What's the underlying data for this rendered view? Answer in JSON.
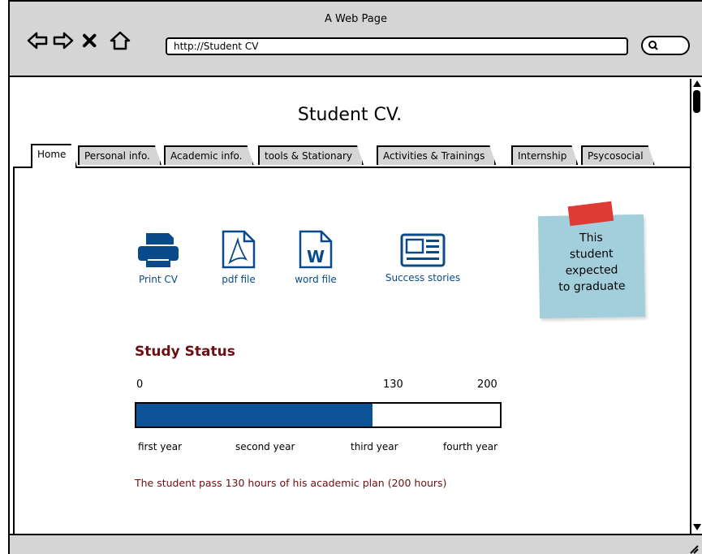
{
  "window": {
    "title": "A Web Page"
  },
  "toolbar": {
    "url": "http://Student CV"
  },
  "page": {
    "title": "Student CV."
  },
  "tabs": [
    {
      "label": "Home"
    },
    {
      "label": "Personal info."
    },
    {
      "label": "Academic info."
    },
    {
      "label": "tools & Stationary"
    },
    {
      "label": "Activities & Trainings"
    },
    {
      "label": "Internship"
    },
    {
      "label": "Psycosocial"
    }
  ],
  "actions": [
    {
      "label": "Print CV",
      "icon": "printer-icon"
    },
    {
      "label": "pdf file",
      "icon": "pdf-file-icon"
    },
    {
      "label": "word file",
      "icon": "word-file-icon"
    },
    {
      "label": "Success stories",
      "icon": "newspaper-icon"
    }
  ],
  "note": {
    "line1": "This",
    "line2": "student",
    "line3": "expected",
    "line4": "to graduate"
  },
  "study": {
    "title": "Study Status",
    "scale": {
      "start": "0",
      "current": "130",
      "end": "200"
    },
    "progress_value": 130,
    "progress_max": 200,
    "years": [
      "first year",
      "second year",
      "third year",
      "fourth year"
    ],
    "summary": "The student pass 130 hours of his academic plan (200 hours)"
  },
  "colors": {
    "bar_fill": "#0b5394",
    "heading": "#6b0f12",
    "icon": "#0a4a8a",
    "note_bg": "#a3cfdd",
    "tape": "#e03a34"
  }
}
